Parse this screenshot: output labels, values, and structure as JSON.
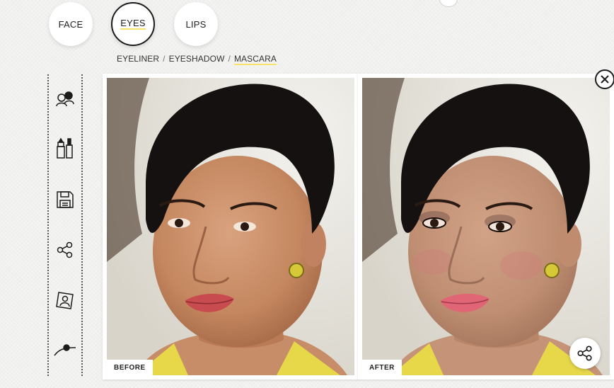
{
  "tabs": [
    {
      "label": "FACE",
      "active": false
    },
    {
      "label": "EYES",
      "active": true
    },
    {
      "label": "LIPS",
      "active": false
    }
  ],
  "subnav": {
    "items": [
      "EYELINER",
      "EYESHADOW",
      "MASCARA"
    ],
    "separator": "/",
    "active": "MASCARA"
  },
  "toolbar": {
    "icons": [
      "faces-icon",
      "makeup-products-icon",
      "save-icon",
      "share-icon",
      "portrait-icon",
      "intensity-slider-icon"
    ]
  },
  "comparison": {
    "before_label": "BEFORE",
    "after_label": "AFTER"
  },
  "colors": {
    "accent_underline": "#f5e36b",
    "icon_stroke": "#1c1c1c"
  }
}
